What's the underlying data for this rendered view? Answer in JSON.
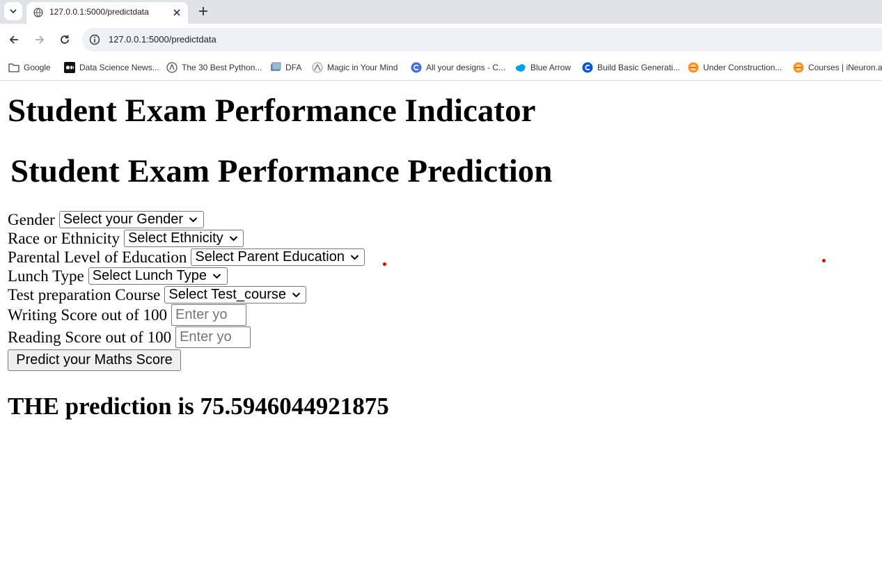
{
  "browser": {
    "tab": {
      "title": "127.0.0.1:5000/predictdata",
      "favicon": "globe-icon"
    },
    "address_bar": {
      "url": "127.0.0.1:5000/predictdata"
    },
    "bookmarks": [
      {
        "label": "Google",
        "icon": "folder-icon"
      },
      {
        "label": "Data Science News...",
        "icon": "medium-icon"
      },
      {
        "label": "The 30 Best Python...",
        "icon": "site-icon"
      },
      {
        "label": "DFA",
        "icon": "site-icon"
      },
      {
        "label": "Magic in Your Mind",
        "icon": "site-icon"
      },
      {
        "label": "All your designs - C...",
        "icon": "canva-icon"
      },
      {
        "label": "Blue Arrow",
        "icon": "salesforce-icon"
      },
      {
        "label": "Build Basic Generati...",
        "icon": "coursera-icon"
      },
      {
        "label": "Under Construction...",
        "icon": "ineuron-icon"
      },
      {
        "label": "Courses | iNeuron.ai",
        "icon": "ineuron-icon"
      }
    ]
  },
  "page": {
    "title": "Student Exam Performance Indicator",
    "subtitle": "Student Exam Performance Prediction",
    "form": {
      "gender": {
        "label": "Gender",
        "selected": "Select your Gender"
      },
      "ethnicity": {
        "label": "Race or Ethnicity",
        "selected": "Select Ethnicity"
      },
      "parental_education": {
        "label": "Parental Level of Education",
        "selected": "Select Parent Education"
      },
      "lunch": {
        "label": "Lunch Type",
        "selected": "Select Lunch Type"
      },
      "test_course": {
        "label": "Test preparation Course",
        "selected": "Select Test_course"
      },
      "writing_score": {
        "label": "Writing Score out of 100",
        "placeholder": "Enter yo"
      },
      "reading_score": {
        "label": "Reading Score out of 100",
        "placeholder": "Enter yo"
      },
      "submit_label": "Predict your Maths Score"
    },
    "result": "THE prediction is 75.5946044921875"
  },
  "colors": {
    "marker_dot": "#dd0000",
    "tab_strip": "#dfe3e8",
    "omnibox": "#edf0f4"
  }
}
